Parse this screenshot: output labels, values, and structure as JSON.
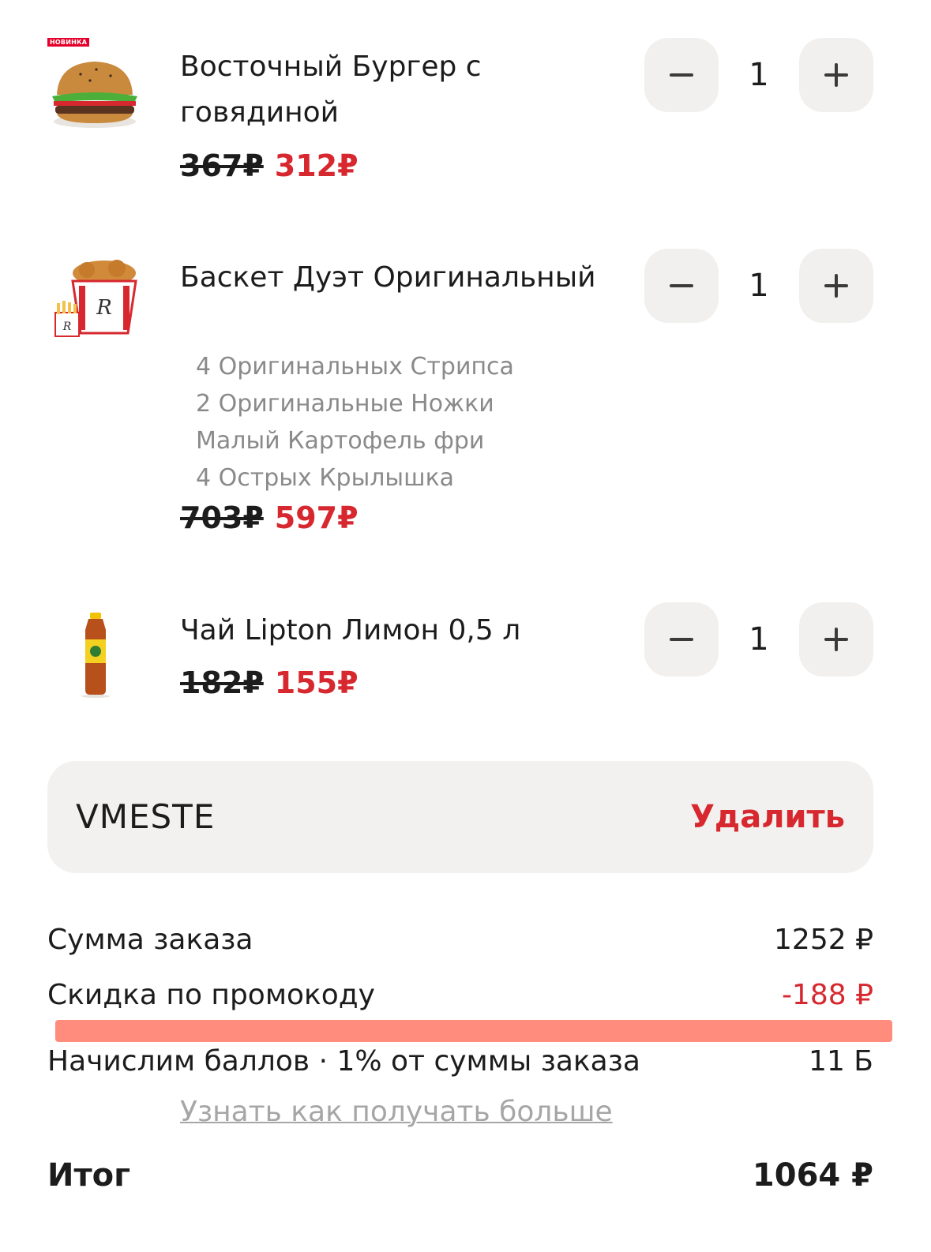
{
  "cart": {
    "items": [
      {
        "badge": "НОВИНКА",
        "image": "burger-image",
        "name": "Восточный Бургер с говядиной",
        "options": [],
        "old_price": "367₽",
        "new_price": "312₽",
        "quantity": "1"
      },
      {
        "image": "bucket-image",
        "name": "Баскет Дуэт Оригинальный",
        "options": [
          "4 Оригинальных Стрипса",
          "2 Оригинальные Ножки",
          "Малый Картофель фри",
          "4 Острых Крылышка"
        ],
        "old_price": "703₽",
        "new_price": "597₽",
        "quantity": "1"
      },
      {
        "image": "tea-bottle-image",
        "name": "Чай Lipton Лимон 0,5 л",
        "options": [],
        "old_price": "182₽",
        "new_price": "155₽",
        "quantity": "1"
      }
    ]
  },
  "promo": {
    "code": "VMESTE",
    "remove_label": "Удалить"
  },
  "summary": {
    "order_sum_label": "Сумма заказа",
    "order_sum_value": "1252 ₽",
    "discount_label": "Скидка по промокоду",
    "discount_value": "-188 ₽",
    "points_label": "Начислим баллов · 1% от суммы заказа",
    "points_value": "11 Б",
    "learn_more_link": "Узнать как получать больше",
    "total_label": "Итог",
    "total_value": "1064 ₽"
  },
  "colors": {
    "accent": "#d7282f",
    "button_bg": "#f1f0ee",
    "highlight": "#ff7f6e"
  }
}
